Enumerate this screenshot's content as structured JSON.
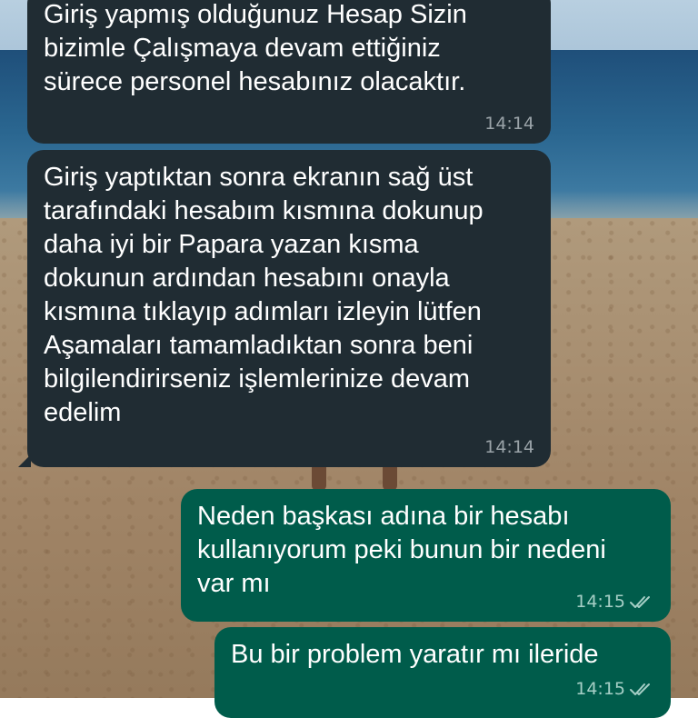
{
  "messages": [
    {
      "direction": "incoming",
      "text": "Giriş yapmış olduğunuz Hesap Sizin\nbizimle Çalışmaya devam ettiğiniz\nsürece personel hesabınız olacaktır.",
      "time": "14:14"
    },
    {
      "direction": "incoming",
      "text": "Giriş yaptıktan sonra ekranın sağ üst\ntarafındaki hesabım kısmına dokunup\ndaha iyi bir Papara yazan kısma\ndokunun ardından hesabını onayla\nkısmına tıklayıp adımları izleyin lütfen\nAşamaları tamamladıktan sonra beni\nbilgilendirirseniz işlemlerinize devam\nedelim",
      "time": "14:14"
    },
    {
      "direction": "outgoing",
      "text": "Neden başkası adına bir hesabı\nkullanıyorum peki bunun bir nedeni\nvar mı",
      "time": "14:15",
      "status": "read"
    },
    {
      "direction": "outgoing",
      "text": "Bu bir problem yaratır mı ileride",
      "time": "14:15",
      "status": "read"
    }
  ],
  "colors": {
    "incoming_bubble": "#202c33",
    "outgoing_bubble": "#005c4b",
    "read_ticks": "#a6cfc6"
  },
  "icons": {
    "read_status": "double-check-icon"
  }
}
